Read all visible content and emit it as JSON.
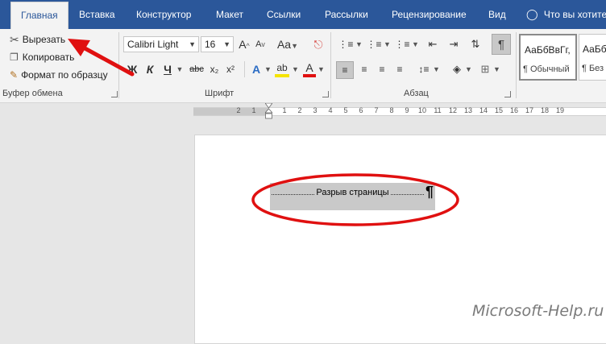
{
  "colors": {
    "accent": "#2b579a",
    "annotation": "#e01010"
  },
  "tabs": [
    "Главная",
    "Вставка",
    "Конструктор",
    "Макет",
    "Ссылки",
    "Рассылки",
    "Рецензирование",
    "Вид"
  ],
  "tell_me": "Что вы хотите",
  "clipboard": {
    "cut": "Вырезать",
    "copy": "Копировать",
    "format_painter": "Формат по образцу",
    "group": "Буфер обмена"
  },
  "font": {
    "name": "Calibri Light",
    "size": "16",
    "group": "Шрифт",
    "grow": "A",
    "shrink": "A",
    "case": "Aa",
    "bold": "Ж",
    "italic": "К",
    "underline": "Ч",
    "strike": "abc",
    "sub": "x₂",
    "sup": "x²",
    "effects": "A",
    "highlight": "ab",
    "color": "A"
  },
  "paragraph": {
    "group": "Абзац",
    "pilcrow": "¶"
  },
  "styles": [
    {
      "sample": "АаБбВвГг,",
      "name": "¶ Обычный"
    },
    {
      "sample": "АаБбВв",
      "name": "¶ Без"
    }
  ],
  "ruler": {
    "numbers": [
      "2",
      "1",
      "1",
      "2",
      "3",
      "4",
      "5",
      "6",
      "7",
      "8",
      "9",
      "10",
      "11",
      "12",
      "13",
      "14",
      "15",
      "16",
      "17",
      "18",
      "19"
    ]
  },
  "document": {
    "page_break": "Разрыв страницы",
    "pilcrow": "¶"
  },
  "watermark": "Microsoft-Help.ru"
}
